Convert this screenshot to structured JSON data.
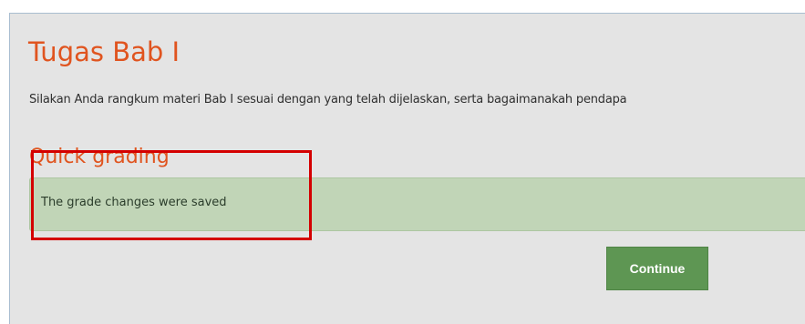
{
  "assignment": {
    "title": "Tugas Bab I",
    "description": "Silakan Anda rangkum materi Bab I sesuai dengan yang telah dijelaskan, serta bagaimanakah pendapa"
  },
  "quick_grading": {
    "heading": "Quick grading",
    "message": "The grade changes were saved",
    "continue_label": "Continue"
  },
  "colors": {
    "heading": "#e0541f",
    "success_background": "#c1d5b7",
    "button": "#5e9653",
    "highlight_border": "#d40000"
  }
}
